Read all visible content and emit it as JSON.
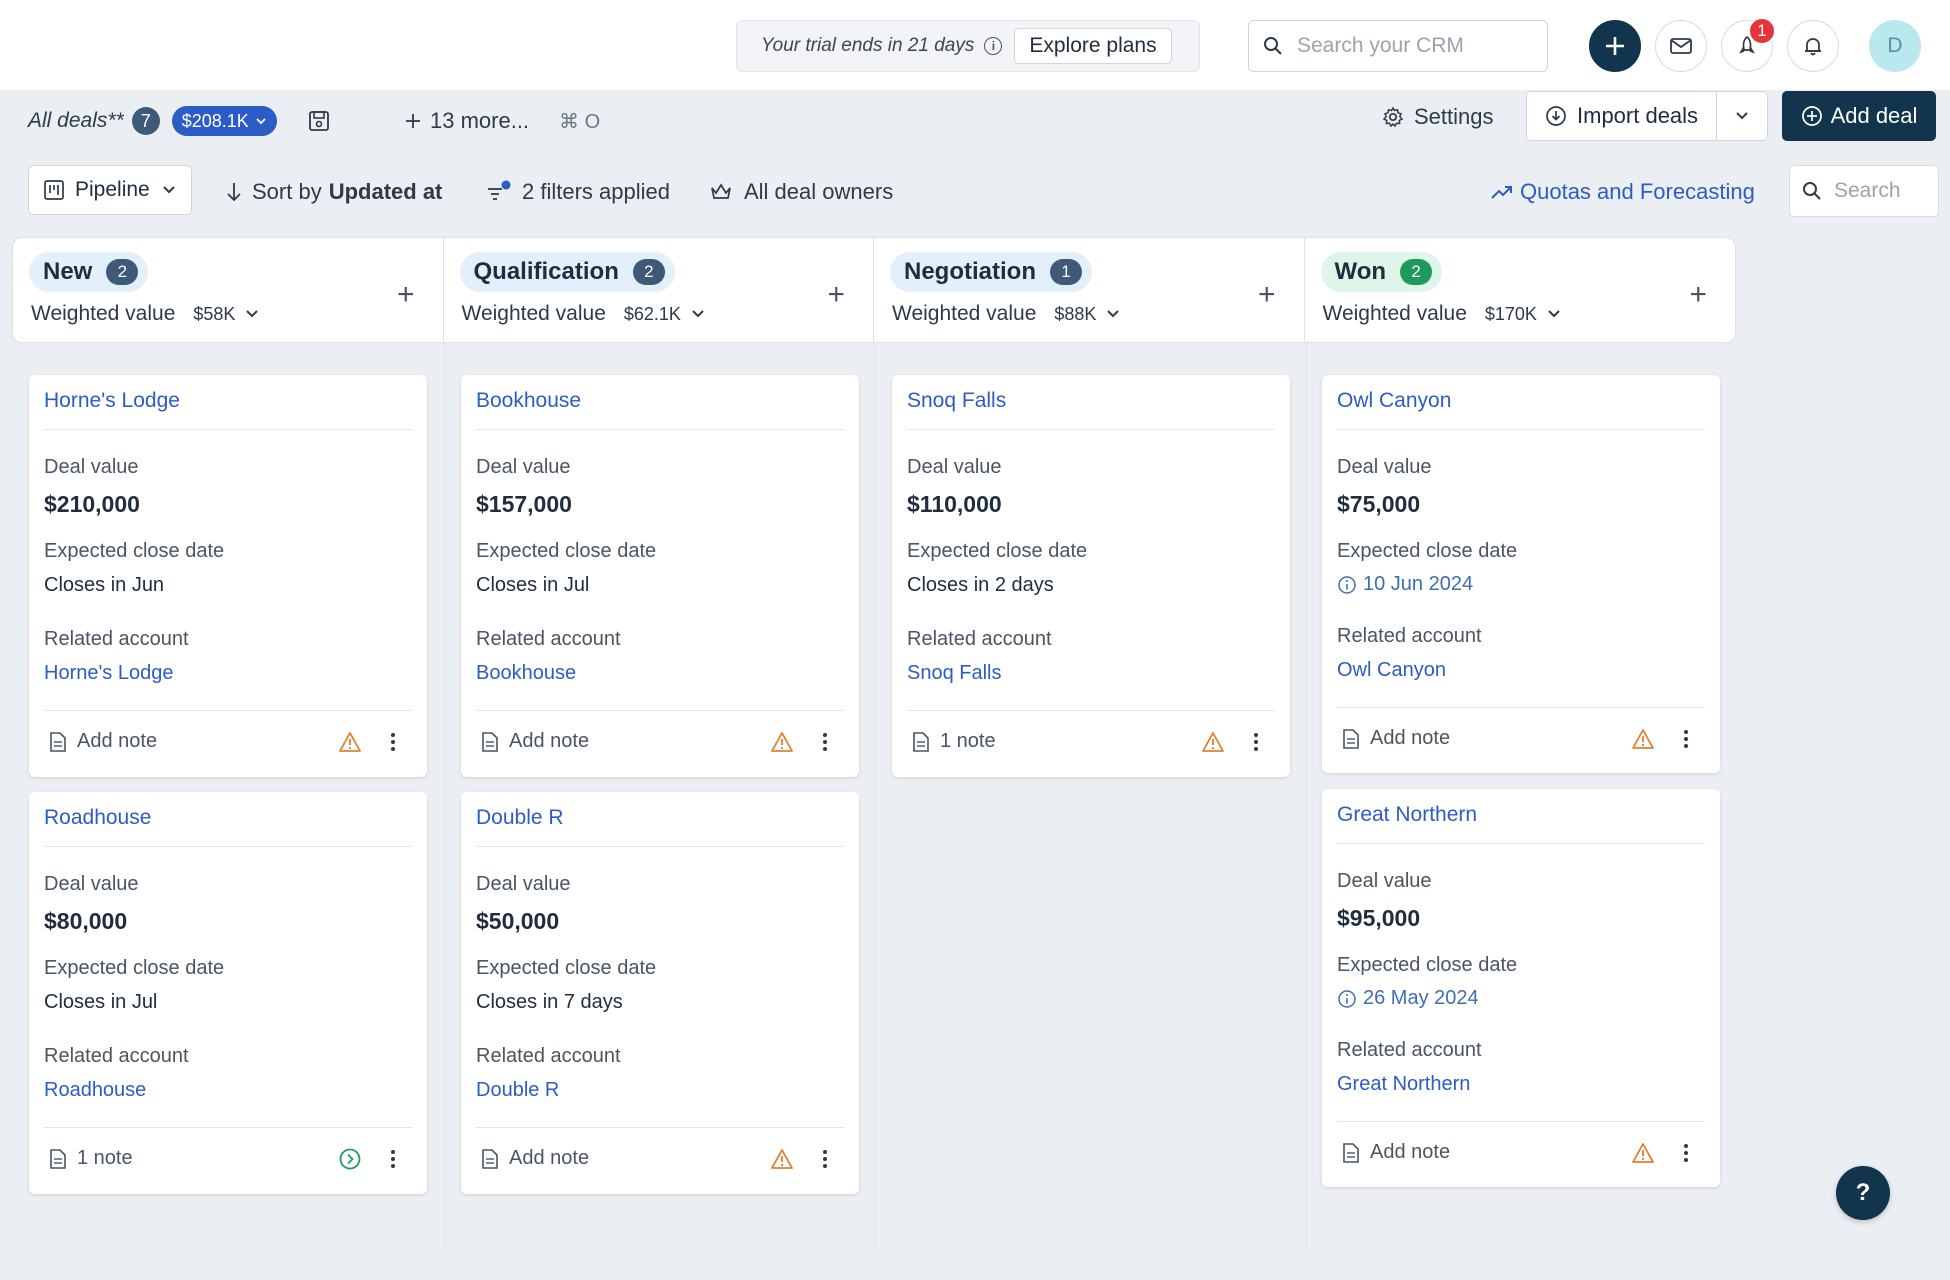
{
  "topbar": {
    "trial_text": "Your trial ends in 21 days",
    "explore_label": "Explore plans",
    "search_placeholder": "Search your CRM",
    "notification_count": "1",
    "avatar_initial": "D"
  },
  "tabs": {
    "active_label": "All deals**",
    "active_count": "7",
    "active_value": "$208.1K",
    "more_label": "13 more...",
    "shortcut": "⌘ O"
  },
  "actions": {
    "settings_label": "Settings",
    "import_label": "Import deals",
    "add_deal_label": "Add deal"
  },
  "toolbar": {
    "view_label": "Pipeline",
    "sort_prefix": "Sort by",
    "sort_field": "Updated at",
    "filters_label": "2 filters applied",
    "owners_label": "All deal owners",
    "quotas_label": "Quotas and Forecasting",
    "search_placeholder": "Search"
  },
  "columns": [
    {
      "name": "New",
      "count": "2",
      "weighted_label": "Weighted value",
      "weighted_value": "$58K",
      "pill_bg": "#e3f0fb",
      "count_bg": "#3d5a78"
    },
    {
      "name": "Qualification",
      "count": "2",
      "weighted_label": "Weighted value",
      "weighted_value": "$62.1K",
      "pill_bg": "#e3f0fb",
      "count_bg": "#3d5a78"
    },
    {
      "name": "Negotiation",
      "count": "1",
      "weighted_label": "Weighted value",
      "weighted_value": "$88K",
      "pill_bg": "#e3f0fb",
      "count_bg": "#3d5a78"
    },
    {
      "name": "Won",
      "count": "2",
      "weighted_label": "Weighted value",
      "weighted_value": "$170K",
      "pill_bg": "#e0f5ea",
      "count_bg": "#1e9a5b"
    }
  ],
  "cards": [
    {
      "title": "Horne's Lodge",
      "value_label": "Deal value",
      "value": "$210,000",
      "date_label": "Expected close date",
      "date": "Closes in Jun",
      "account_label": "Related account",
      "account": "Horne's Lodge",
      "note": "Add note",
      "status": "warning"
    },
    {
      "title": "Roadhouse",
      "value_label": "Deal value",
      "value": "$80,000",
      "date_label": "Expected close date",
      "date": "Closes in Jul",
      "account_label": "Related account",
      "account": "Roadhouse",
      "note": "1 note",
      "status": "ok"
    },
    {
      "title": "Bookhouse",
      "value_label": "Deal value",
      "value": "$157,000",
      "date_label": "Expected close date",
      "date": "Closes in Jul",
      "account_label": "Related account",
      "account": "Bookhouse",
      "note": "Add note",
      "status": "warning"
    },
    {
      "title": "Double R",
      "value_label": "Deal value",
      "value": "$50,000",
      "date_label": "Expected close date",
      "date": "Closes in 7 days",
      "account_label": "Related account",
      "account": "Double R",
      "note": "Add note",
      "status": "warning"
    },
    {
      "title": "Snoq Falls",
      "value_label": "Deal value",
      "value": "$110,000",
      "date_label": "Expected close date",
      "date": "Closes in 2 days",
      "account_label": "Related account",
      "account": "Snoq Falls",
      "note": "1 note",
      "status": "warning"
    },
    {
      "title": "Owl Canyon",
      "value_label": "Deal value",
      "value": "$75,000",
      "date_label": "Expected close date",
      "date": "10 Jun 2024",
      "account_label": "Related account",
      "account": "Owl Canyon",
      "note": "Add note",
      "status": "warning"
    },
    {
      "title": "Great Northern",
      "value_label": "Deal value",
      "value": "$95,000",
      "date_label": "Expected close date",
      "date": "26 May 2024",
      "account_label": "Related account",
      "account": "Great Northern",
      "note": "Add note",
      "status": "warning"
    }
  ],
  "colors": {
    "accent": "#2c5cc5",
    "primary_dark": "#12344d",
    "warning": "#e0802b",
    "success": "#1e9a5b"
  },
  "help_label": "?"
}
